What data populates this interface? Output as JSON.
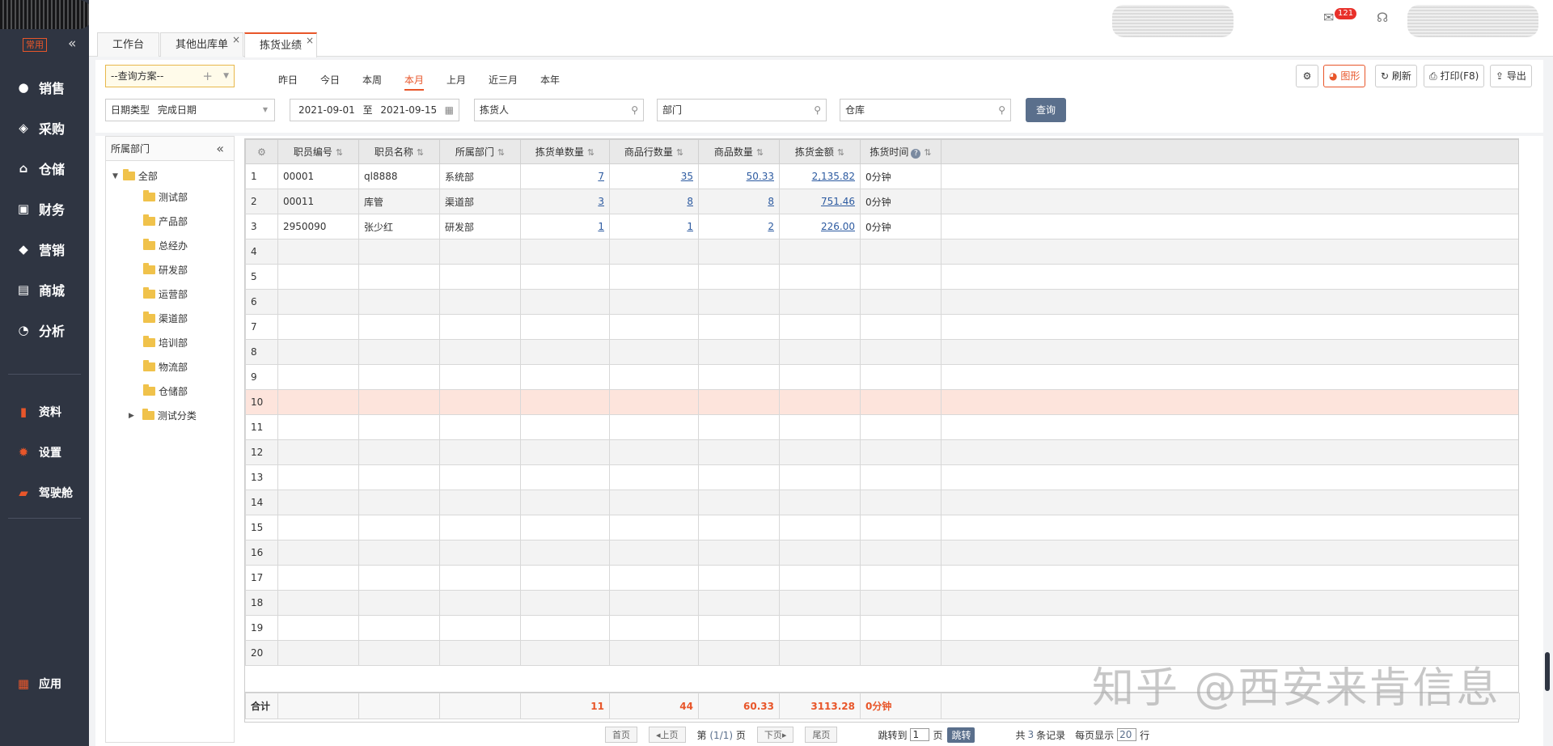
{
  "sidebar": {
    "common_label": "常用",
    "menu": [
      {
        "label": "销售",
        "icon": "sales-icon"
      },
      {
        "label": "采购",
        "icon": "purchase-icon"
      },
      {
        "label": "仓储",
        "icon": "warehouse-icon"
      },
      {
        "label": "财务",
        "icon": "finance-icon"
      },
      {
        "label": "营销",
        "icon": "marketing-icon"
      },
      {
        "label": "商城",
        "icon": "mall-icon"
      },
      {
        "label": "分析",
        "icon": "analysis-icon"
      }
    ],
    "lower": [
      {
        "label": "资料",
        "icon": "data-icon"
      },
      {
        "label": "设置",
        "icon": "settings-icon"
      },
      {
        "label": "驾驶舱",
        "icon": "cockpit-icon"
      }
    ],
    "apps_label": "应用"
  },
  "tabs": [
    {
      "label": "工作台"
    },
    {
      "label": "其他出库单"
    },
    {
      "label": "拣货业绩",
      "active": true
    }
  ],
  "header": {
    "message_badge": "121"
  },
  "toolbar": {
    "scheme_placeholder": "--查询方案--",
    "periods": [
      "昨日",
      "今日",
      "本周",
      "本月",
      "上月",
      "近三月",
      "本年"
    ],
    "active_period": "本月",
    "buttons": {
      "chart": "图形",
      "refresh": "刷新",
      "print": "打印(F8)",
      "export": "导出"
    },
    "date_type_label": "日期类型",
    "date_type_value": "完成日期",
    "date_from": "2021-09-01",
    "date_to_sep": "至",
    "date_to": "2021-09-15",
    "picker_placeholder": "拣货人",
    "dept_placeholder": "部门",
    "warehouse_placeholder": "仓库",
    "query_label": "查询"
  },
  "dept_panel": {
    "title": "所属部门",
    "root": "全部",
    "children": [
      "测试部",
      "产品部",
      "总经办",
      "研发部",
      "运营部",
      "渠道部",
      "培训部",
      "物流部",
      "仓储部",
      "测试分类"
    ]
  },
  "grid": {
    "columns": [
      "职员编号",
      "职员名称",
      "所属部门",
      "拣货单数量",
      "商品行数量",
      "商品数量",
      "拣货金额",
      "拣货时间"
    ],
    "rows": [
      {
        "no": "1",
        "code": "00001",
        "name": "ql8888",
        "dept": "系统部",
        "orders": "7",
        "lines": "35",
        "qty": "50.33",
        "amount": "2,135.82",
        "time": "0分钟"
      },
      {
        "no": "2",
        "code": "00011",
        "name": "库管",
        "dept": "渠道部",
        "orders": "3",
        "lines": "8",
        "qty": "8",
        "amount": "751.46",
        "time": "0分钟"
      },
      {
        "no": "3",
        "code": "2950090",
        "name": "张少红",
        "dept": "研发部",
        "orders": "1",
        "lines": "1",
        "qty": "2",
        "amount": "226.00",
        "time": "0分钟"
      }
    ],
    "empty_row_numbers": [
      "4",
      "5",
      "6",
      "7",
      "8",
      "9",
      "10",
      "11",
      "12",
      "13",
      "14",
      "15",
      "16",
      "17",
      "18",
      "19",
      "20"
    ],
    "highlight_row": "10",
    "total": {
      "label": "合计",
      "orders": "11",
      "lines": "44",
      "qty": "60.33",
      "amount": "3113.28",
      "time": "0分钟"
    }
  },
  "pager": {
    "first": "首页",
    "prev": "上页",
    "page_prefix": "第",
    "page_info": "(1/1)",
    "page_suffix": "页",
    "next": "下页",
    "last": "尾页",
    "jump_label": "跳转到",
    "jump_value": "1",
    "jump_unit": "页",
    "jump_button": "跳转",
    "total_prefix": "共",
    "total_count": "3",
    "total_suffix": "条记录",
    "per_page_label": "每页显示",
    "per_page_value": "20",
    "per_page_unit": "行"
  },
  "watermark": "知乎 @西安来肯信息"
}
